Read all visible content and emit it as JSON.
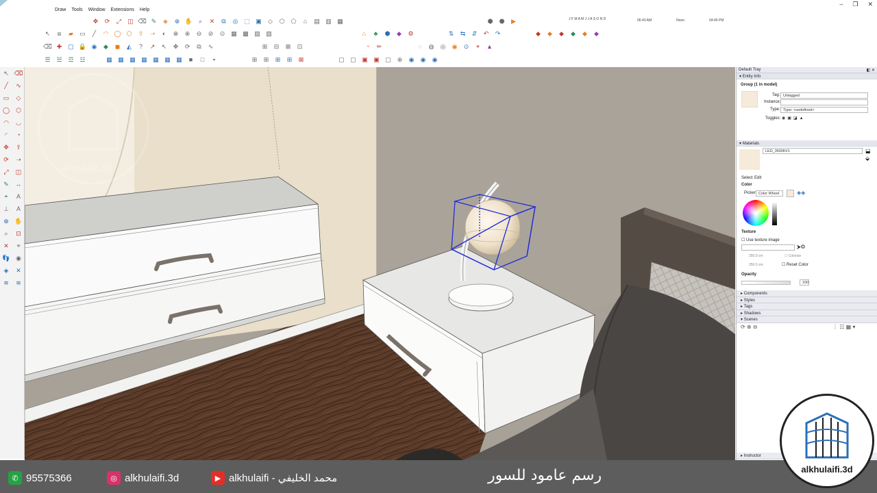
{
  "menu": [
    "Draw",
    "Tools",
    "Window",
    "Extensions",
    "Help"
  ],
  "shadow_bar": {
    "months": "J F M A M J J A S O N D",
    "time_start": "06:43 AM",
    "time_mid": "Noon",
    "time_end": "04:45 PM"
  },
  "tray": {
    "title": "Default Tray",
    "entity_info": {
      "header": "Entity Info",
      "selection": "Group (1 in model)",
      "tag_label": "Tag:",
      "tag_value": "Untagged",
      "instance_label": "Instance:",
      "instance_value": "",
      "type_label": "Type:",
      "type_value": "Type: <undefined>",
      "toggles_label": "Toggles:"
    },
    "materials": {
      "header": "Materials",
      "material_name": "LED_3500K#1",
      "tab_select": "Select",
      "tab_edit": "Edit",
      "color_label": "Color",
      "picker_label": "Picker:",
      "picker_value": "Color Wheel",
      "texture_label": "Texture",
      "use_texture": "Use texture image",
      "width": "250.0 cm",
      "height": "250.0 cm",
      "colorize": "Colorize",
      "reset_color": "Reset Color",
      "opacity_label": "Opacity",
      "opacity_value": "100",
      "swatch_color": "#f6ead9"
    },
    "collapsed_panels": [
      "Components",
      "Styles",
      "Tags",
      "Shadows",
      "Scenes"
    ],
    "footer_panel": "Instructor"
  },
  "bottom": {
    "whatsapp": "95575366",
    "instagram": "alkhulaifi.3d",
    "youtube": "alkhulaifi - محمد الخليفي",
    "caption": "رسم عامود للسور"
  },
  "logo_text": "alkhulaifi.3d",
  "watermark_text": "alkhulaifi.3d",
  "colors": {
    "bottom_bar": "#5d5d5d",
    "selection": "#1f2bd6",
    "wall": "#a9a29a",
    "floor": "#5a3a28"
  }
}
